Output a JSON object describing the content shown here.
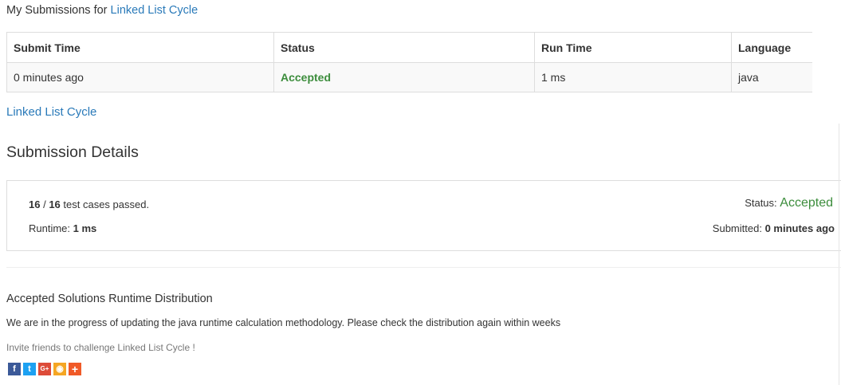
{
  "header": {
    "prefix": "My Submissions for",
    "problem_link": "Linked List Cycle"
  },
  "submissions_table": {
    "columns": [
      "Submit Time",
      "Status",
      "Run Time",
      "Language"
    ],
    "rows": [
      {
        "submit_time": "0 minutes ago",
        "status": "Accepted",
        "run_time": "1 ms",
        "language": "java"
      }
    ]
  },
  "problem_link": "Linked List Cycle",
  "details": {
    "title": "Submission Details",
    "passed": "16",
    "total": "16",
    "cases_suffix": "test cases passed.",
    "runtime_label": "Runtime:",
    "runtime_value": "1 ms",
    "status_label": "Status:",
    "status_value": "Accepted",
    "submitted_label": "Submitted:",
    "submitted_value": "0 minutes ago"
  },
  "distribution": {
    "title": "Accepted Solutions Runtime Distribution",
    "message": "We are in the progress of updating the java runtime calculation methodology. Please check the distribution again within weeks"
  },
  "invite": "Invite friends to challenge Linked List Cycle !",
  "share_icons": [
    {
      "name": "facebook-icon",
      "glyph": "f",
      "color": "#3b5998"
    },
    {
      "name": "twitter-icon",
      "glyph": "t",
      "color": "#1da1f2"
    },
    {
      "name": "google-plus-icon",
      "glyph": "G+",
      "color": "#dd4b39"
    },
    {
      "name": "weibo-icon",
      "glyph": "◉",
      "color": "#f5a623"
    },
    {
      "name": "more-share-icon",
      "glyph": "+",
      "color": "#f05a28"
    }
  ],
  "colors": {
    "link": "#2a7ab9",
    "accepted": "#3c8d3c",
    "border": "#dddddd"
  }
}
